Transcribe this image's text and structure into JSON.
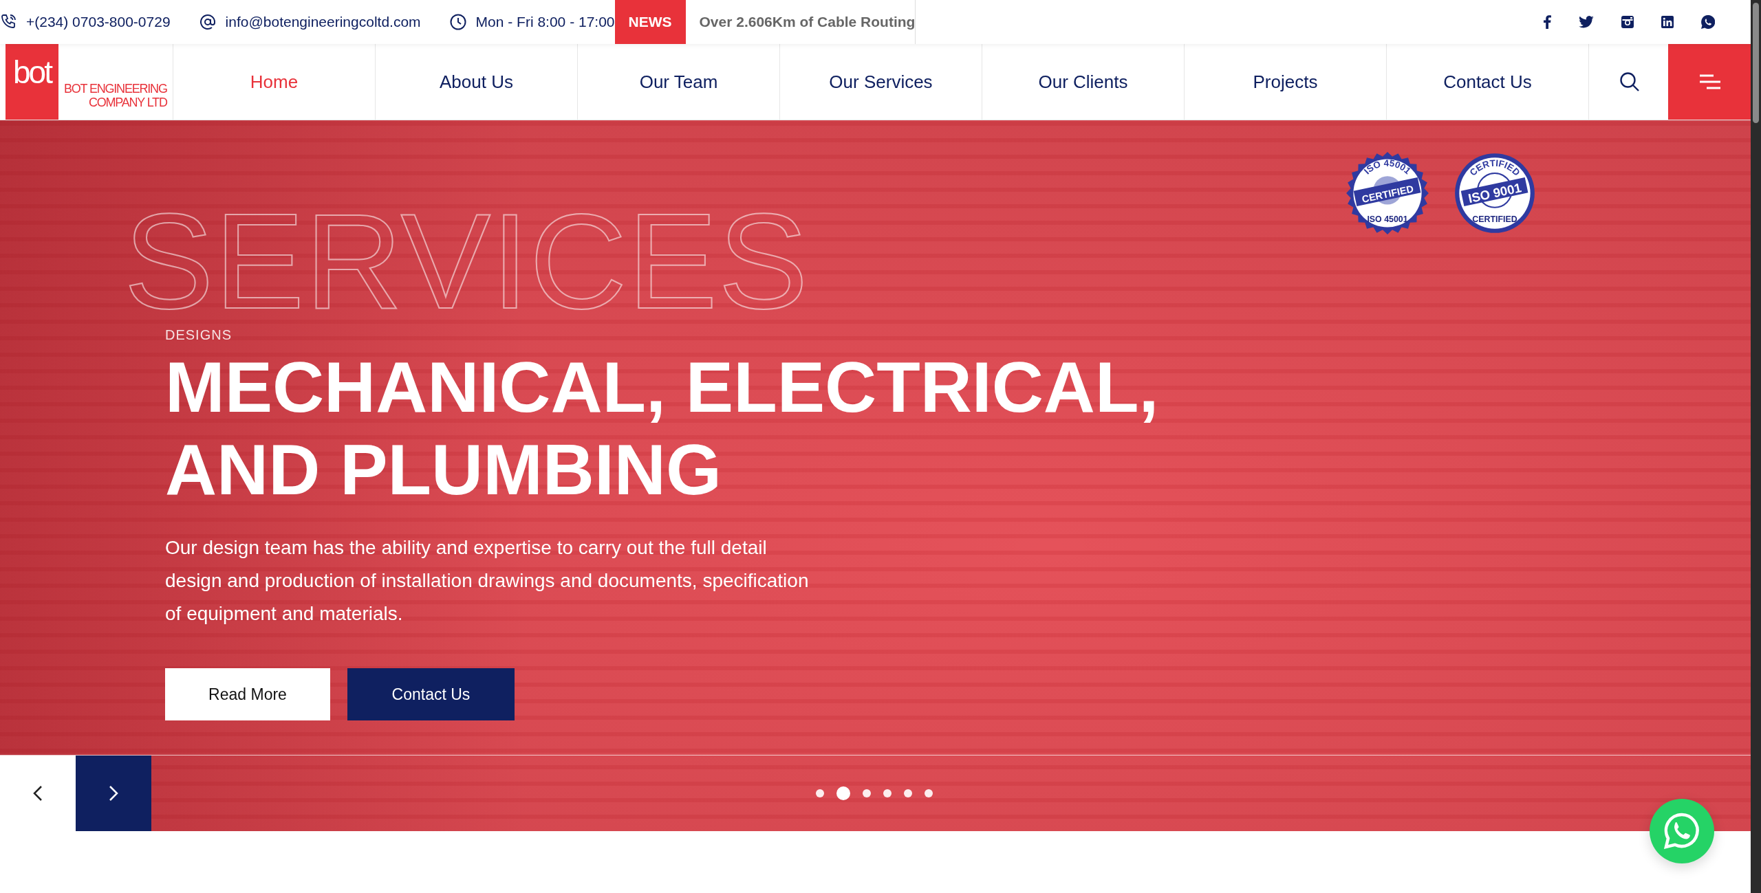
{
  "topbar": {
    "phone": "+(234) 0703-800-0729",
    "email": "info@botengineeringcoltd.com",
    "hours": "Mon - Fri 8:00 - 17:00",
    "news_label": "NEWS",
    "news_text": "Over 2.606Km of Cable Routing",
    "social": [
      {
        "kind": "facebook"
      },
      {
        "kind": "twitter"
      },
      {
        "kind": "instagram"
      },
      {
        "kind": "linkedin"
      },
      {
        "kind": "whatsapp"
      }
    ]
  },
  "logo": {
    "mark": "bot",
    "name_lines": [
      "BOT ENGINEERING",
      "COMPANY LTD"
    ]
  },
  "nav": [
    {
      "label": "Home",
      "selected": true
    },
    {
      "label": "About Us",
      "selected": false
    },
    {
      "label": "Our Team",
      "selected": false
    },
    {
      "label": "Our Services",
      "selected": false
    },
    {
      "label": "Our Clients",
      "selected": false
    },
    {
      "label": "Projects",
      "selected": false
    },
    {
      "label": "Contact Us",
      "selected": false
    }
  ],
  "hero": {
    "watermark": "SERVICES",
    "eyebrow": "DESIGNS",
    "heading_lines": [
      "MECHANICAL, ELECTRICAL,",
      "AND PLUMBING"
    ],
    "text": "Our design team has the ability and expertise to carry out the full detail design and production of installation drawings and documents, specification of equipment and materials.",
    "buttons": [
      {
        "label": "Read More",
        "kind": "light"
      },
      {
        "label": "Contact Us",
        "kind": "dark"
      }
    ],
    "badges": [
      {
        "kind": "serrated",
        "ring_top": "ISO 45001",
        "band": "CERTIFIED",
        "ring_bottom": "ISO 45001"
      },
      {
        "kind": "round",
        "ring_top": "CERTIFIED",
        "band": "ISO 9001",
        "ring_bottom": "CERTIFIED"
      }
    ]
  },
  "slider": {
    "dots": [
      {
        "selected": false
      },
      {
        "selected": true
      },
      {
        "selected": false
      },
      {
        "selected": false
      },
      {
        "selected": false
      },
      {
        "selected": false
      }
    ]
  }
}
